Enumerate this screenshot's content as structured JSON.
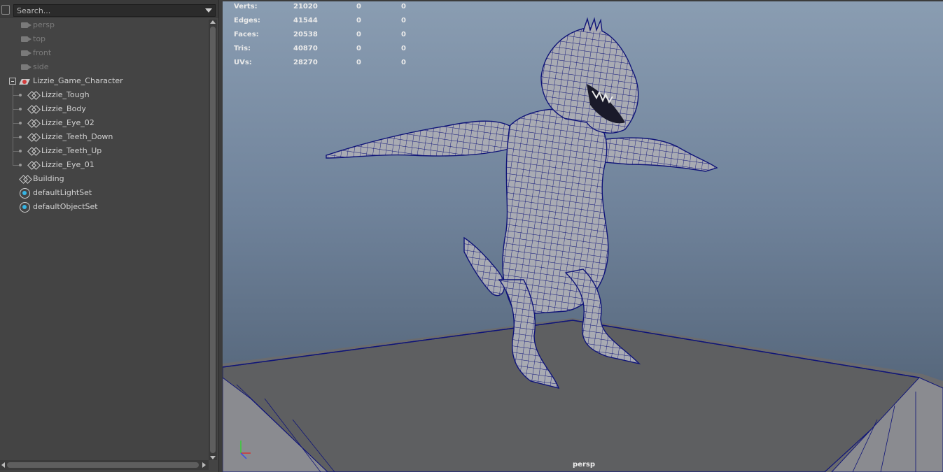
{
  "outliner": {
    "search_placeholder": "Search...",
    "items": [
      {
        "label": "persp",
        "type": "camera"
      },
      {
        "label": "top",
        "type": "camera"
      },
      {
        "label": "front",
        "type": "camera"
      },
      {
        "label": "side",
        "type": "camera"
      },
      {
        "label": "Lizzie_Game_Character",
        "type": "group",
        "expanded": true
      },
      {
        "label": "Lizzie_Tough",
        "type": "mesh"
      },
      {
        "label": "Lizzie_Body",
        "type": "mesh"
      },
      {
        "label": "Lizzie_Eye_02",
        "type": "mesh"
      },
      {
        "label": "Lizzie_Teeth_Down",
        "type": "mesh"
      },
      {
        "label": "Lizzie_Teeth_Up",
        "type": "mesh"
      },
      {
        "label": "Lizzie_Eye_01",
        "type": "mesh"
      },
      {
        "label": "Building",
        "type": "mesh"
      },
      {
        "label": "defaultLightSet",
        "type": "set"
      },
      {
        "label": "defaultObjectSet",
        "type": "set"
      }
    ]
  },
  "viewport": {
    "camera_label": "persp",
    "hud": [
      {
        "label": "Verts:",
        "values": [
          "21020",
          "0",
          "0"
        ]
      },
      {
        "label": "Edges:",
        "values": [
          "41544",
          "0",
          "0"
        ]
      },
      {
        "label": "Faces:",
        "values": [
          "20538",
          "0",
          "0"
        ]
      },
      {
        "label": "Tris:",
        "values": [
          "40870",
          "0",
          "0"
        ]
      },
      {
        "label": "UVs:",
        "values": [
          "28270",
          "0",
          "0"
        ]
      }
    ],
    "wireframe_color": "#0f1478",
    "mesh_color": "#a9abb3"
  }
}
